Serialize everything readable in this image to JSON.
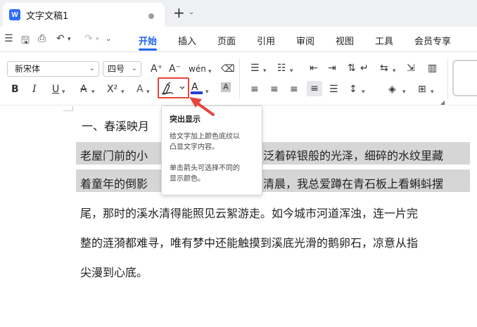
{
  "titlebar": {
    "doc_title": "文字文稿1",
    "logo": "W",
    "new_tab": "+",
    "new_tab_caret": "⌄"
  },
  "quick_access": {
    "menu_icon": "menu-icon",
    "save_icon": "save-icon",
    "print_preview_icon": "print-preview-icon",
    "undo_icon": "undo-icon",
    "redo_icon": "redo-icon",
    "more_icon": "chevron-down-icon"
  },
  "menu": {
    "items": [
      "开始",
      "插入",
      "页面",
      "引用",
      "审阅",
      "视图",
      "工具",
      "会员专享"
    ],
    "active": "开始"
  },
  "ribbon": {
    "font_name": "新宋体",
    "font_size": "四号",
    "bold": "B",
    "italic": "I",
    "underline": "U",
    "strike": "A",
    "superscript": "X²",
    "text_effect": "A",
    "font_color": "A",
    "char_shading": "A",
    "grow_font": "A⁺",
    "shrink_font": "A⁻",
    "phonetic": "wén",
    "clear_format": "⌫",
    "font_color_hex": "#1f3fd6",
    "highlight_border_hex": "#e8453c"
  },
  "tooltip": {
    "title": "突出显示",
    "line1": "给文字加上颜色底纹以",
    "line2": "凸显文字内容。",
    "line3": "单击箭头可选择不同的",
    "line4": "显示颜色。"
  },
  "document": {
    "heading": "一、春溪映月",
    "lines": [
      "老屋门前的小",
      "泛着碎银般的光泽，细碎的水纹里藏",
      "着童年的倒影",
      "清晨，我总爱蹲在青石板上看蝌蚪摆",
      "尾，那时的溪水清得能照见云絮游走。如今城市河道浑浊，连一片完",
      "整的涟漪都难寻，唯有梦中还能触摸到溪底光滑的鹅卵石，凉意从指",
      "尖漫到心底。"
    ]
  }
}
